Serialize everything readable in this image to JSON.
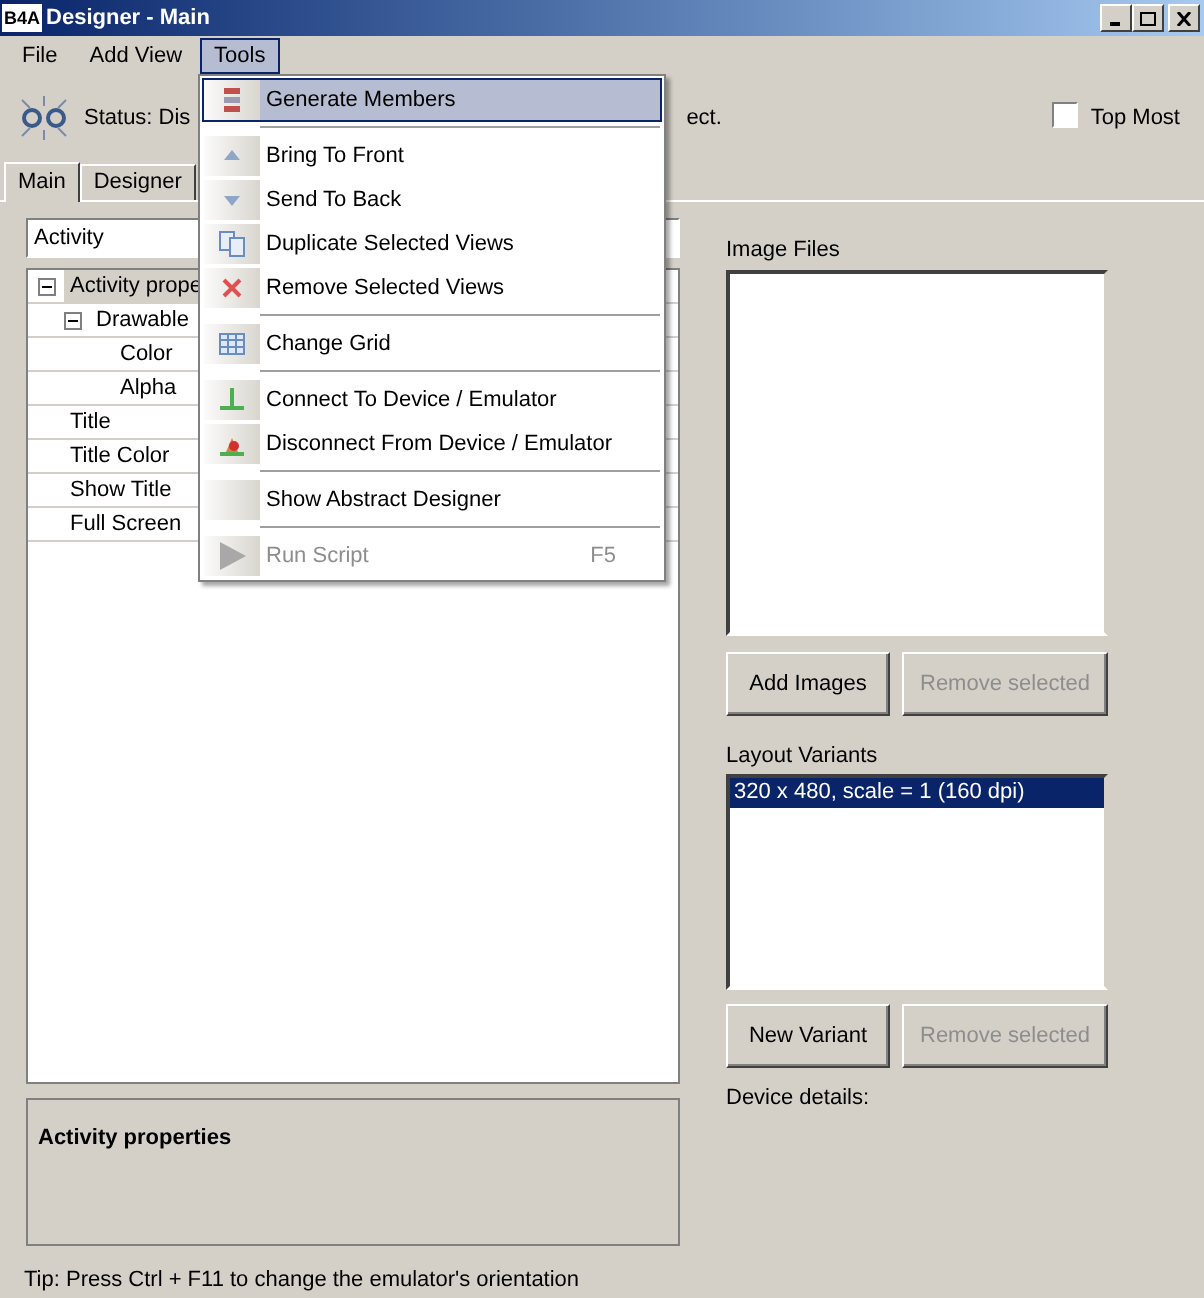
{
  "window": {
    "title": "Designer - Main",
    "logo": "B4A"
  },
  "menu_bar": [
    {
      "label": "File",
      "selected": false
    },
    {
      "label": "Add View",
      "selected": false
    },
    {
      "label": "Tools",
      "selected": true
    }
  ],
  "status": {
    "text_left": "Status: Dis",
    "text_right": "ect."
  },
  "top_most": {
    "label": "Top Most",
    "checked": false
  },
  "tabs": [
    {
      "label": "Main",
      "selected": true
    },
    {
      "label": "Designer",
      "selected": false
    }
  ],
  "module_combo": {
    "value": "Activity"
  },
  "tree": [
    {
      "label": "Activity prope",
      "expanded": true,
      "selected": true,
      "children": [
        {
          "label": "Drawable",
          "expanded": true,
          "selected": false,
          "children": [
            {
              "label": "Color",
              "selected": false
            },
            {
              "label": "Alpha",
              "selected": false
            }
          ]
        },
        {
          "label": "Title",
          "selected": false
        },
        {
          "label": "Title Color",
          "selected": false
        },
        {
          "label": "Show Title",
          "selected": false
        },
        {
          "label": "Full Screen",
          "selected": false
        }
      ]
    }
  ],
  "description": {
    "title": "Activity properties"
  },
  "tip": "Tip: Press Ctrl + F11 to change the emulator's orientation",
  "image_files": {
    "label": "Image Files",
    "buttons": [
      {
        "label": "Add Images",
        "disabled": false
      },
      {
        "label": "Remove selected",
        "disabled": true
      }
    ]
  },
  "layout_variants": {
    "label": "Layout Variants",
    "items": [
      {
        "label": "320 x 480, scale = 1 (160 dpi)",
        "selected": true
      }
    ],
    "buttons": [
      {
        "label": "New Variant",
        "disabled": false
      },
      {
        "label": "Remove selected",
        "disabled": true
      }
    ]
  },
  "device_details": "Device details:",
  "tools_menu": [
    {
      "kind": "item",
      "label": "Generate Members",
      "selected": true,
      "disabled": false
    },
    {
      "kind": "separator"
    },
    {
      "kind": "item",
      "label": "Bring To Front",
      "selected": false,
      "disabled": false
    },
    {
      "kind": "item",
      "label": "Send To Back",
      "selected": false,
      "disabled": false
    },
    {
      "kind": "item",
      "label": "Duplicate Selected Views",
      "selected": false,
      "disabled": false
    },
    {
      "kind": "item",
      "label": "Remove Selected Views",
      "selected": false,
      "disabled": false
    },
    {
      "kind": "separator"
    },
    {
      "kind": "item",
      "label": "Change Grid",
      "selected": false,
      "disabled": false
    },
    {
      "kind": "separator"
    },
    {
      "kind": "item",
      "label": "Connect To Device / Emulator",
      "selected": false,
      "disabled": false
    },
    {
      "kind": "item",
      "label": "Disconnect From Device / Emulator",
      "selected": false,
      "disabled": false
    },
    {
      "kind": "separator"
    },
    {
      "kind": "item",
      "label": "Show Abstract Designer",
      "selected": false,
      "disabled": false
    },
    {
      "kind": "separator"
    },
    {
      "kind": "item",
      "label": "Run Script",
      "shortcut": "F5",
      "selected": false,
      "disabled": true
    }
  ]
}
